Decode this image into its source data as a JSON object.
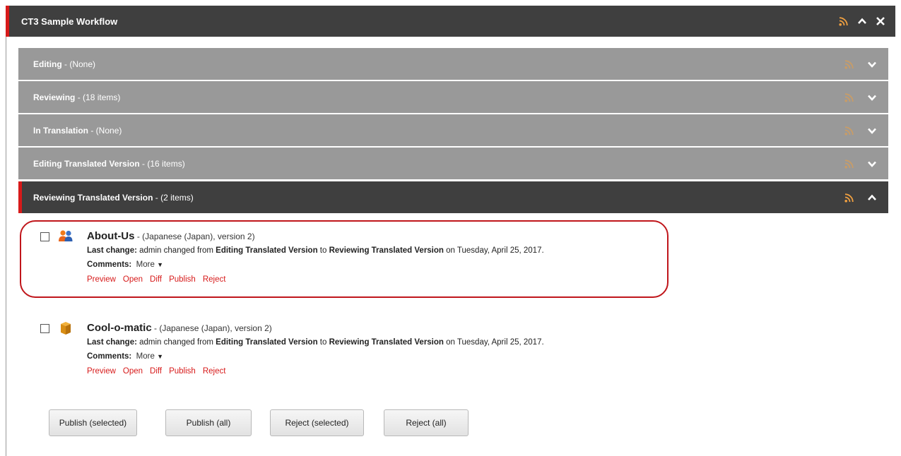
{
  "window": {
    "title": "CT3 Sample Workflow"
  },
  "colors": {
    "accent": "#d71a1a",
    "rss": "#f0a040",
    "header": "#3f3f3f",
    "stage": "#999999"
  },
  "stages": [
    {
      "name": "Editing",
      "count": " - (None)",
      "expanded": false
    },
    {
      "name": "Reviewing",
      "count": " - (18 items)",
      "expanded": false
    },
    {
      "name": "In Translation",
      "count": " - (None)",
      "expanded": false
    },
    {
      "name": "Editing Translated Version",
      "count": " - (16 items)",
      "expanded": false
    },
    {
      "name": "Reviewing Translated Version",
      "count": " - (2 items)",
      "expanded": true
    }
  ],
  "items": [
    {
      "name": "About-Us",
      "meta": " - (Japanese (Japan), version 2)",
      "last_change_label": "Last change:",
      "change_prefix": " admin changed from ",
      "from_stage": "Editing Translated Version",
      "to_word": " to ",
      "to_stage": "Reviewing Translated Version",
      "date_text": " on Tuesday, April 25, 2017.",
      "comments_label": "Comments:",
      "more_label": "More",
      "icon": "group-icon",
      "actions": [
        "Preview",
        "Open",
        "Diff",
        "Publish",
        "Reject"
      ]
    },
    {
      "name": "Cool-o-matic",
      "meta": " - (Japanese (Japan), version 2)",
      "last_change_label": "Last change:",
      "change_prefix": " admin changed from ",
      "from_stage": "Editing Translated Version",
      "to_word": " to ",
      "to_stage": "Reviewing Translated Version",
      "date_text": " on Tuesday, April 25, 2017.",
      "comments_label": "Comments:",
      "more_label": "More",
      "icon": "product-box-icon",
      "actions": [
        "Preview",
        "Open",
        "Diff",
        "Publish",
        "Reject"
      ]
    }
  ],
  "buttons": {
    "publish_selected": "Publish (selected)",
    "publish_all": "Publish (all)",
    "reject_selected": "Reject (selected)",
    "reject_all": "Reject (all)"
  }
}
